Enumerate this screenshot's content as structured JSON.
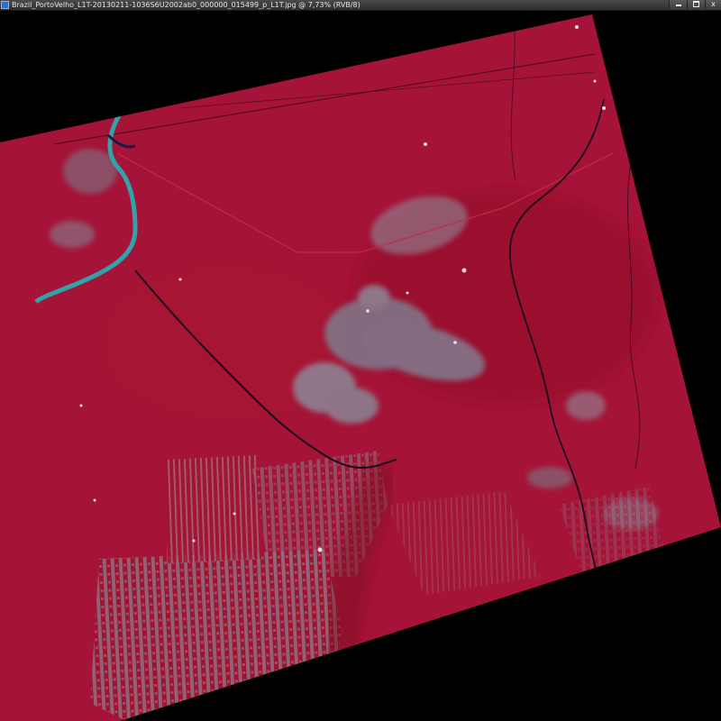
{
  "window": {
    "title": "Brazil_PortoVelho_L1T-20130211-1036S6U2002ab0_000000_015499_p_L1T.jpg @ 7,73% (RVB/8)",
    "min_glyph": "",
    "max_glyph": "",
    "close_glyph": "x"
  },
  "icons": {
    "app": "photoshop-document-icon",
    "minimize": "minimize-icon",
    "maximize": "maximize-icon",
    "close": "close-icon"
  },
  "image": {
    "description_kind": "false-color satellite scene",
    "colors": {
      "vegetation": "#a0102e",
      "vegetation_dark": "#7d0a24",
      "cleared_land": "#8e8a96",
      "river": "#2fa3a8",
      "background": "#000000"
    }
  }
}
